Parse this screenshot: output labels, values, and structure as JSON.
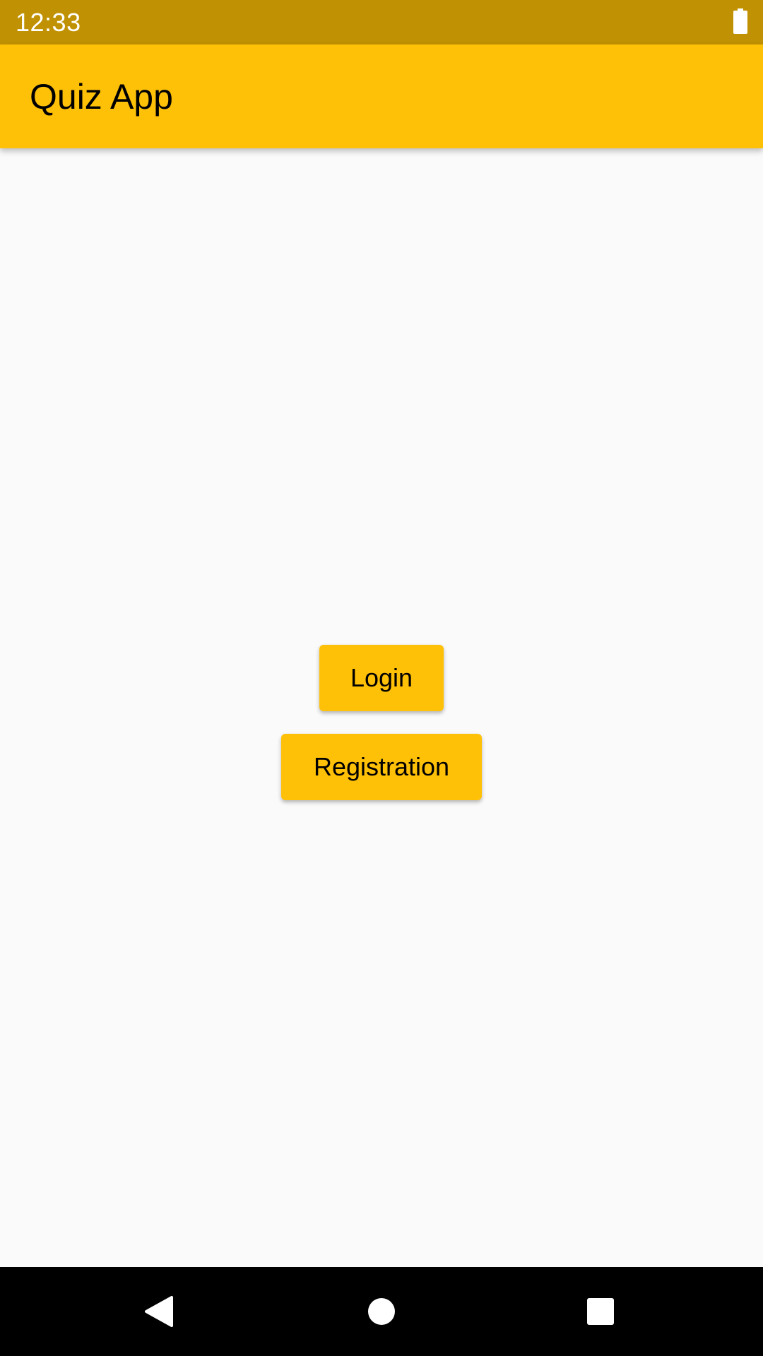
{
  "status_bar": {
    "time": "12:33",
    "battery_icon": "battery-full-icon",
    "background_color": "#c09102"
  },
  "app_bar": {
    "title": "Quiz App",
    "background_color": "#ffc107"
  },
  "main": {
    "login_label": "Login",
    "registration_label": "Registration",
    "button_color": "#ffc107"
  },
  "nav_bar": {
    "back_icon": "back-triangle-icon",
    "home_icon": "home-circle-icon",
    "recents_icon": "recents-square-icon"
  }
}
